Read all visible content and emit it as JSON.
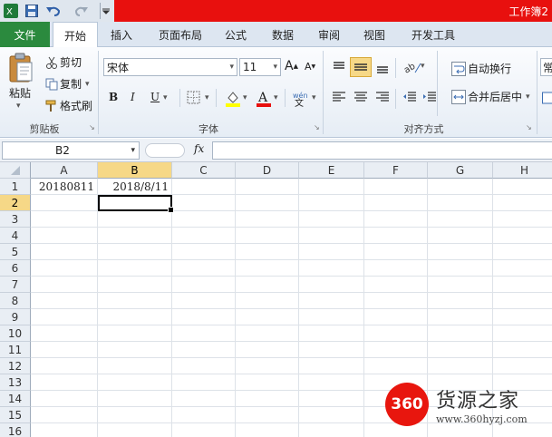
{
  "window": {
    "title": "工作簿2"
  },
  "quick_access": {
    "app_icon": "excel-icon",
    "save_icon": "save-icon",
    "undo_icon": "undo-icon",
    "redo_icon": "redo-icon",
    "customize_icon": "customize-icon"
  },
  "tabs": [
    "文件",
    "开始",
    "插入",
    "页面布局",
    "公式",
    "数据",
    "审阅",
    "视图",
    "开发工具"
  ],
  "ribbon": {
    "clipboard": {
      "paste": "粘贴",
      "cut": "剪切",
      "copy": "复制",
      "format_painter": "格式刷",
      "group": "剪贴板"
    },
    "font": {
      "name": "宋体",
      "size": "11",
      "bold": "B",
      "italic": "I",
      "underline": "U",
      "group": "字体"
    },
    "alignment": {
      "wrap_text": "自动换行",
      "merge_center": "合并后居中",
      "group": "对齐方式"
    },
    "overflow": "常"
  },
  "formula_bar": {
    "name_box": "B2",
    "fx": "fx",
    "value": ""
  },
  "columns": [
    "A",
    "B",
    "C",
    "D",
    "E",
    "F",
    "G",
    "H"
  ],
  "rows": [
    "1",
    "2",
    "3",
    "4",
    "5",
    "6",
    "7",
    "8",
    "9",
    "10",
    "11",
    "12",
    "13",
    "14",
    "15",
    "16"
  ],
  "cells": {
    "A1": "20180811",
    "B1": "2018/8/11"
  },
  "selected_cell": "B2",
  "watermark": {
    "logo": "360",
    "name": "货源之家",
    "url": "www.360hyzj.com"
  },
  "colors": {
    "title_red": "#e8100e",
    "file_tab": "#2b8a3e",
    "selected_header": "#f6d887",
    "watermark_red": "#e8160e"
  }
}
